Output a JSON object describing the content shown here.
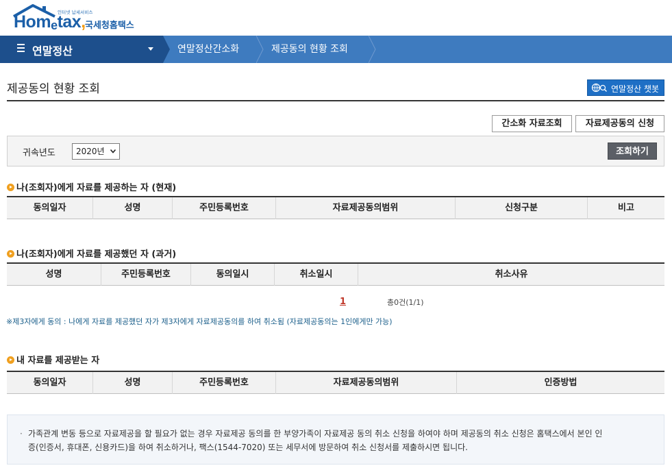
{
  "header": {
    "logo_small": "인터넷 납세서비스",
    "logo_main_prefix": "Hom",
    "logo_main_e": "e",
    "logo_main_suffix": "tax",
    "logo_sub": "국세청홈택스"
  },
  "nav": {
    "menu_label": "연말정산",
    "breadcrumbs": [
      "연말정산간소화",
      "제공동의 현황 조회"
    ]
  },
  "page": {
    "title": "제공동의 현황 조회",
    "chatbot_label": "연말정산 챗봇"
  },
  "actions": {
    "simplified_lookup": "간소화 자료조회",
    "consent_request": "자료제공동의 신청"
  },
  "search": {
    "year_label": "귀속년도",
    "year_value": "2020년",
    "search_button": "조회하기"
  },
  "section_current": {
    "title": "나(조회자)에게 자료를 제공하는 자 (현재)",
    "columns": [
      "동의일자",
      "성명",
      "주민등록번호",
      "자료제공동의범위",
      "신청구분",
      "비고"
    ]
  },
  "section_past": {
    "title": "나(조회자)에게 자료를 제공했던 자 (과거)",
    "columns": [
      "성명",
      "주민등록번호",
      "동의일시",
      "취소일시",
      "취소사유"
    ],
    "pager_current": "1",
    "pager_total": "총0건(1/1)",
    "note": "※제3자에게 동의 : 나에게 자료를 제공했던 자가 제3자에게 자료제공동의를 하여 취소됨 (자료제공동의는 1인에게만 가능)"
  },
  "section_receiving": {
    "title": "내 자료를 제공받는 자",
    "columns": [
      "동의일자",
      "성명",
      "주민등록번호",
      "자료제공동의범위",
      "인증방법"
    ]
  },
  "info": {
    "line1": "가족관계 변동 등으로 자료제공을 할 필요가 없는 경우 자료제공 동의를 한 부양가족이 자료제공 동의 취소 신청을 하여야 하며 제공동의 취소 신청은 홈택스에서 본인 인",
    "line2": "증(인증서, 휴대폰, 신용카드)을 하여 취소하거나, 팩스(1544-7020) 또는 세무서에 방문하여 취소 신청서를 제출하시면 됩니다."
  },
  "colors": {
    "brand_blue": "#1b5fa8",
    "nav_dark": "#1d4f8c",
    "nav_light": "#3e7bbf",
    "accent_orange": "#f0a020",
    "chatbot_blue": "#1e6fc5"
  }
}
